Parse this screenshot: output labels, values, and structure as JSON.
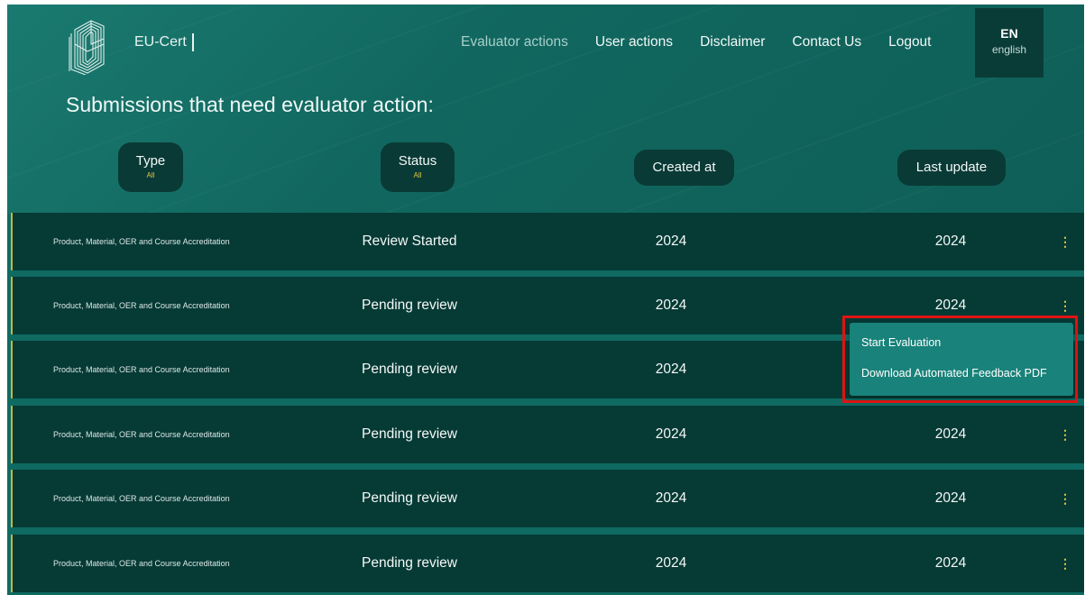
{
  "brand": {
    "name": "EU-Cert"
  },
  "nav": {
    "items": [
      {
        "label": "Evaluator actions"
      },
      {
        "label": "User actions"
      },
      {
        "label": "Disclaimer"
      },
      {
        "label": "Contact Us"
      },
      {
        "label": "Logout"
      }
    ],
    "language": {
      "code": "EN",
      "name": "english"
    }
  },
  "page": {
    "title": "Submissions that need evaluator action:"
  },
  "filters": {
    "type": {
      "label": "Type",
      "value": "All"
    },
    "status": {
      "label": "Status",
      "value": "All"
    },
    "created": {
      "label": "Created at"
    },
    "updated": {
      "label": "Last update"
    }
  },
  "rows": [
    {
      "type": "Product, Material, OER and Course Accreditation",
      "status": "Review Started",
      "created": "2024",
      "updated": "2024"
    },
    {
      "type": "Product, Material, OER and Course Accreditation",
      "status": "Pending review",
      "created": "2024",
      "updated": "2024"
    },
    {
      "type": "Product, Material, OER and Course Accreditation",
      "status": "Pending review",
      "created": "2024",
      "updated": ""
    },
    {
      "type": "Product, Material, OER and Course Accreditation",
      "status": "Pending review",
      "created": "2024",
      "updated": "2024"
    },
    {
      "type": "Product, Material, OER and Course Accreditation",
      "status": "Pending review",
      "created": "2024",
      "updated": "2024"
    },
    {
      "type": "Product, Material, OER and Course Accreditation",
      "status": "Pending review",
      "created": "2024",
      "updated": "2024"
    }
  ],
  "row_menu": {
    "items": [
      {
        "label": "Start Evaluation"
      },
      {
        "label": "Download Automated Feedback PDF"
      }
    ]
  },
  "icons": {
    "logo": "eu-cert-logo",
    "row_action": "kebab-icon"
  },
  "colors": {
    "background": "#0f6a62",
    "row": "#063a35",
    "accent": "#e6c542",
    "menu": "#19827a",
    "highlight": "#e01414"
  }
}
